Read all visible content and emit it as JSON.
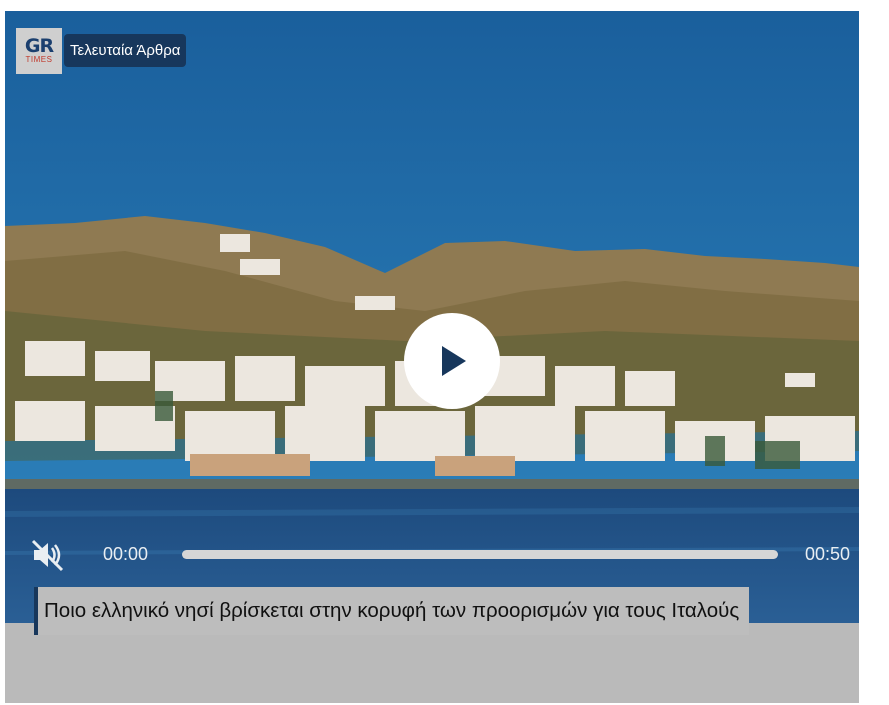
{
  "player": {
    "brand": {
      "line1": "GR",
      "line2": "TIMES"
    },
    "category_label": "Τελευταία Άρθρα",
    "controls": {
      "play_icon": "play-icon",
      "mute_icon": "muted-speaker-icon",
      "current_time": "00:00",
      "duration": "00:50",
      "progress": 0
    }
  },
  "article": {
    "title": "Ποιο ελληνικό νησί βρίσκεται στην κορυφή των προορισμών για τους Ιταλούς"
  },
  "colors": {
    "accent": "#17375c",
    "sea": "#1f4f85",
    "sky": "#1c6aa2"
  }
}
